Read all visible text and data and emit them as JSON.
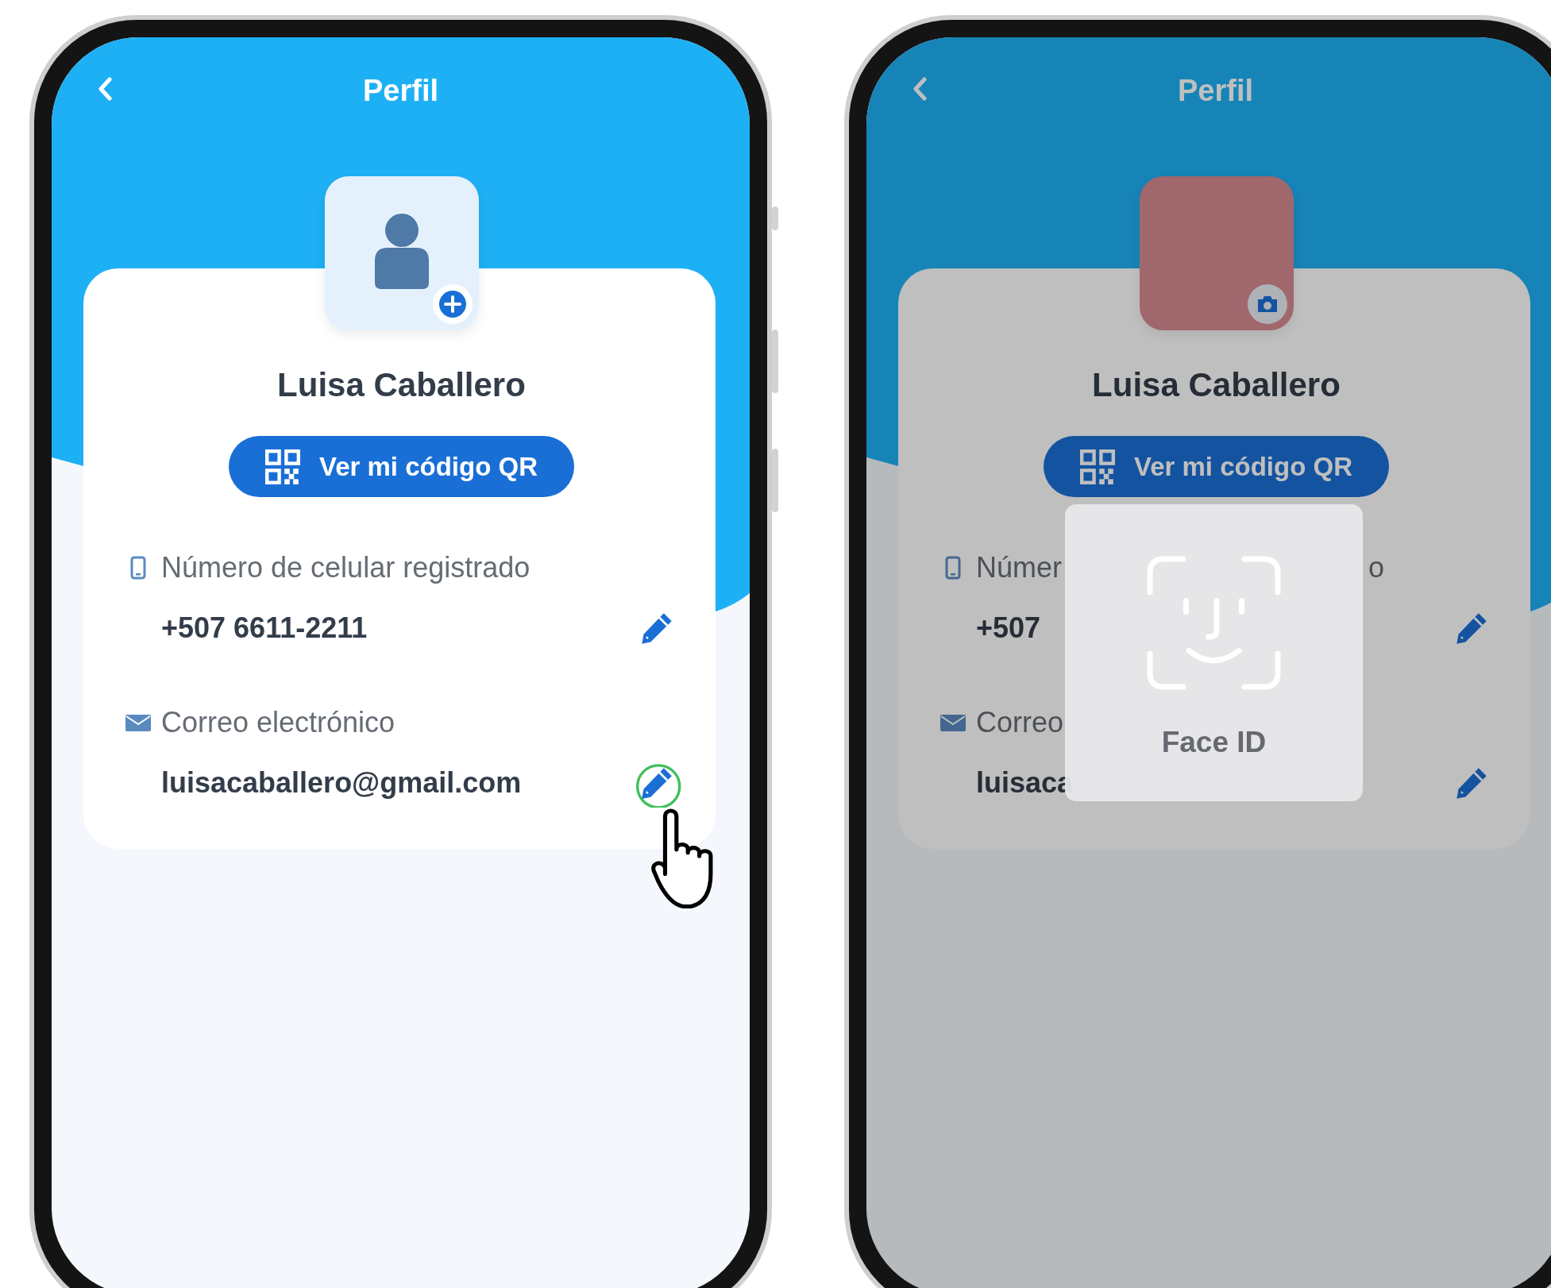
{
  "screens": [
    {
      "title": "Perfil",
      "dimmed": false,
      "avatar": {
        "kind": "placeholder"
      },
      "name": "Luisa Caballero",
      "qr_button": "Ver mi código QR",
      "fields": [
        {
          "kind": "phone",
          "label": "Número de celular registrado",
          "value": "+507 6611-2211",
          "pointer": false
        },
        {
          "kind": "mail",
          "label": "Correo electrónico",
          "value": "luisacaballero@gmail.com",
          "pointer": true
        }
      ]
    },
    {
      "title": "Perfil",
      "dimmed": true,
      "avatar": {
        "kind": "photo"
      },
      "name": "Luisa Caballero",
      "qr_button": "Ver mi código QR",
      "fields": [
        {
          "kind": "phone",
          "label": "Númer",
          "label_tail": "o",
          "value": "+507",
          "pointer": false
        },
        {
          "kind": "mail",
          "label": "Correo",
          "value": "luisaca",
          "pointer": false
        }
      ],
      "dialog": {
        "label": "Face ID"
      }
    }
  ]
}
